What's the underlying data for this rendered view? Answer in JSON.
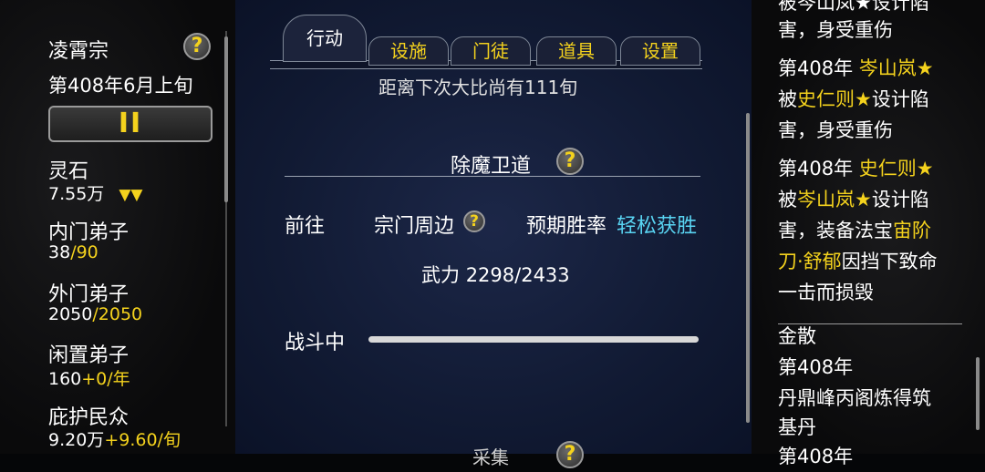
{
  "left": {
    "sect_name": "凌霄宗",
    "date": "第408年6月上旬",
    "pause_symbol": "II",
    "stats": [
      {
        "label": "灵石",
        "value": "7.55万",
        "trend": "▼▼"
      },
      {
        "label": "内门弟子",
        "value": "38",
        "value2": "/90"
      },
      {
        "label": "外门弟子",
        "value": "2050",
        "value2": "/2050"
      },
      {
        "label": "闲置弟子",
        "value": "160",
        "value2": "+0/年"
      },
      {
        "label": "庇护民众",
        "value": "9.20万",
        "value2": "+9.60/旬"
      }
    ]
  },
  "tabs": [
    "行动",
    "设施",
    "门徒",
    "道具",
    "设置"
  ],
  "main": {
    "top_cut_text": "距离下次大比尚有111旬",
    "section_title": "除魔卫道",
    "goto_label": "前往",
    "destination": "宗门周边",
    "win_rate_label": "预期胜率",
    "win_rate_value": "轻松获胜",
    "power_label": "武力",
    "power_value": "2298/2433",
    "status_label": "战斗中",
    "bottom_cut_text": "采集"
  },
  "right_log": {
    "entry0_line1": "被岑山岚★设计陷",
    "entry0_line2": "害，身受重伤",
    "entry1_line1_a": "第408年 ",
    "entry1_line1_b": "岑山岚★",
    "entry1_line2_a": "被",
    "entry1_line2_b": "史仁则★",
    "entry1_line2_c": "设计陷",
    "entry1_line3": "害，身受重伤",
    "entry2_line1_a": "第408年 ",
    "entry2_line1_b": "史仁则★",
    "entry2_line2_a": "被",
    "entry2_line2_b": "岑山岚★",
    "entry2_line2_c": "设计陷",
    "entry2_line3_a": "害，装备法宝",
    "entry2_line3_b": "宙阶",
    "entry2_line4_a": "刀·舒郁",
    "entry2_line4_b": "因挡下致命",
    "entry2_line5": "一击而损毁",
    "section_title": "金散",
    "entry3_line1": "第408年",
    "entry3_line2": "丹鼎峰丙阁炼得筑",
    "entry3_line3": "基丹",
    "entry4_line1": "第408年"
  },
  "colors": {
    "accent_yellow": "#f4d21d",
    "accent_cyan": "#59d4f2",
    "panel_blue": "#141d38"
  }
}
